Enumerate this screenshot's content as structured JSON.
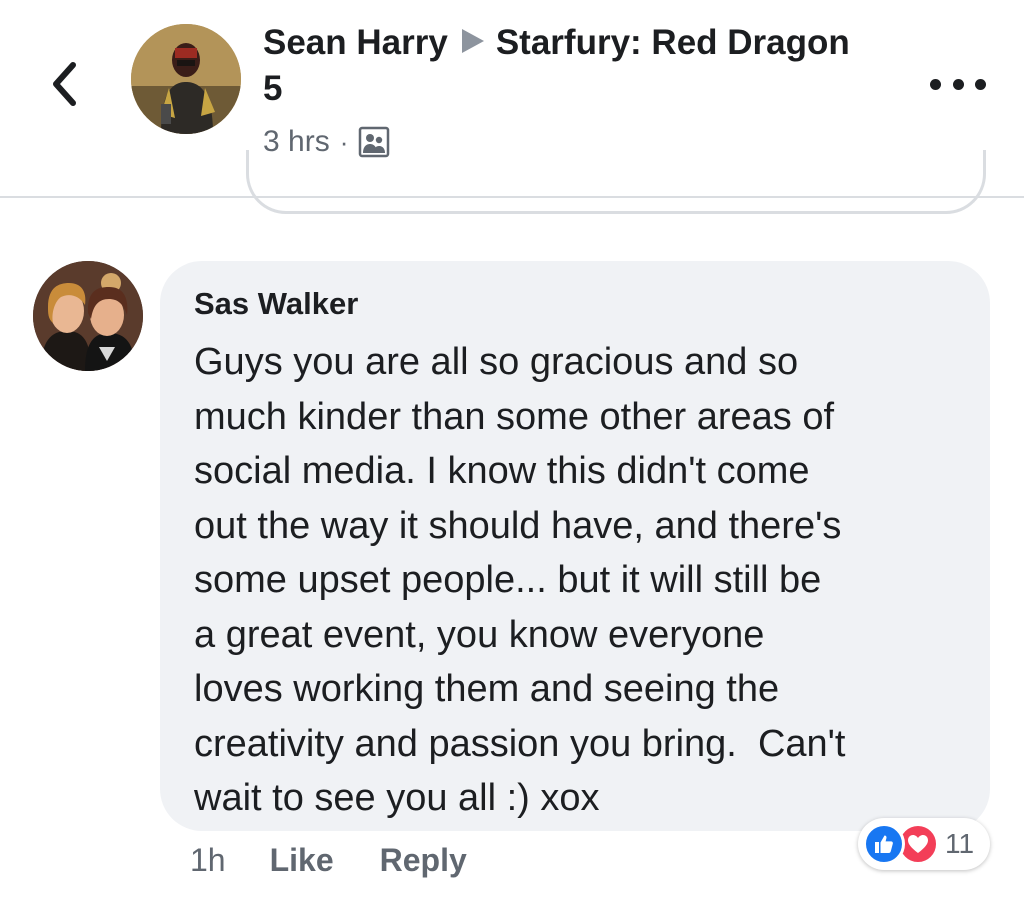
{
  "post_header": {
    "author": "Sean Harry",
    "group": "Starfury: Red Dragon 5",
    "time": "3 hrs",
    "separator": "·",
    "audience_icon": "group-audience-icon",
    "back_icon": "chevron-left-icon",
    "more_icon": "more-options-icon"
  },
  "comment": {
    "author": "Sas Walker",
    "text_lines": [
      "Guys you are all so gracious and so",
      "much kinder than some other areas of",
      "social media. I know this didn't come",
      "out the way it should have, and there's",
      "some upset people... but it will still be",
      "a great event, you know everyone",
      "loves working them and seeing the",
      "creativity and passion you bring.  Can't",
      "wait to see you all :) xox"
    ],
    "time": "1h",
    "like_label": "Like",
    "reply_label": "Reply",
    "reactions": {
      "types": [
        "like",
        "love"
      ],
      "count": "11"
    }
  },
  "colors": {
    "bubble_bg": "#f0f2f5",
    "secondary_text": "#606770",
    "like_blue": "#1877f2",
    "love_red": "#f33e58",
    "divider": "#dadde1"
  }
}
